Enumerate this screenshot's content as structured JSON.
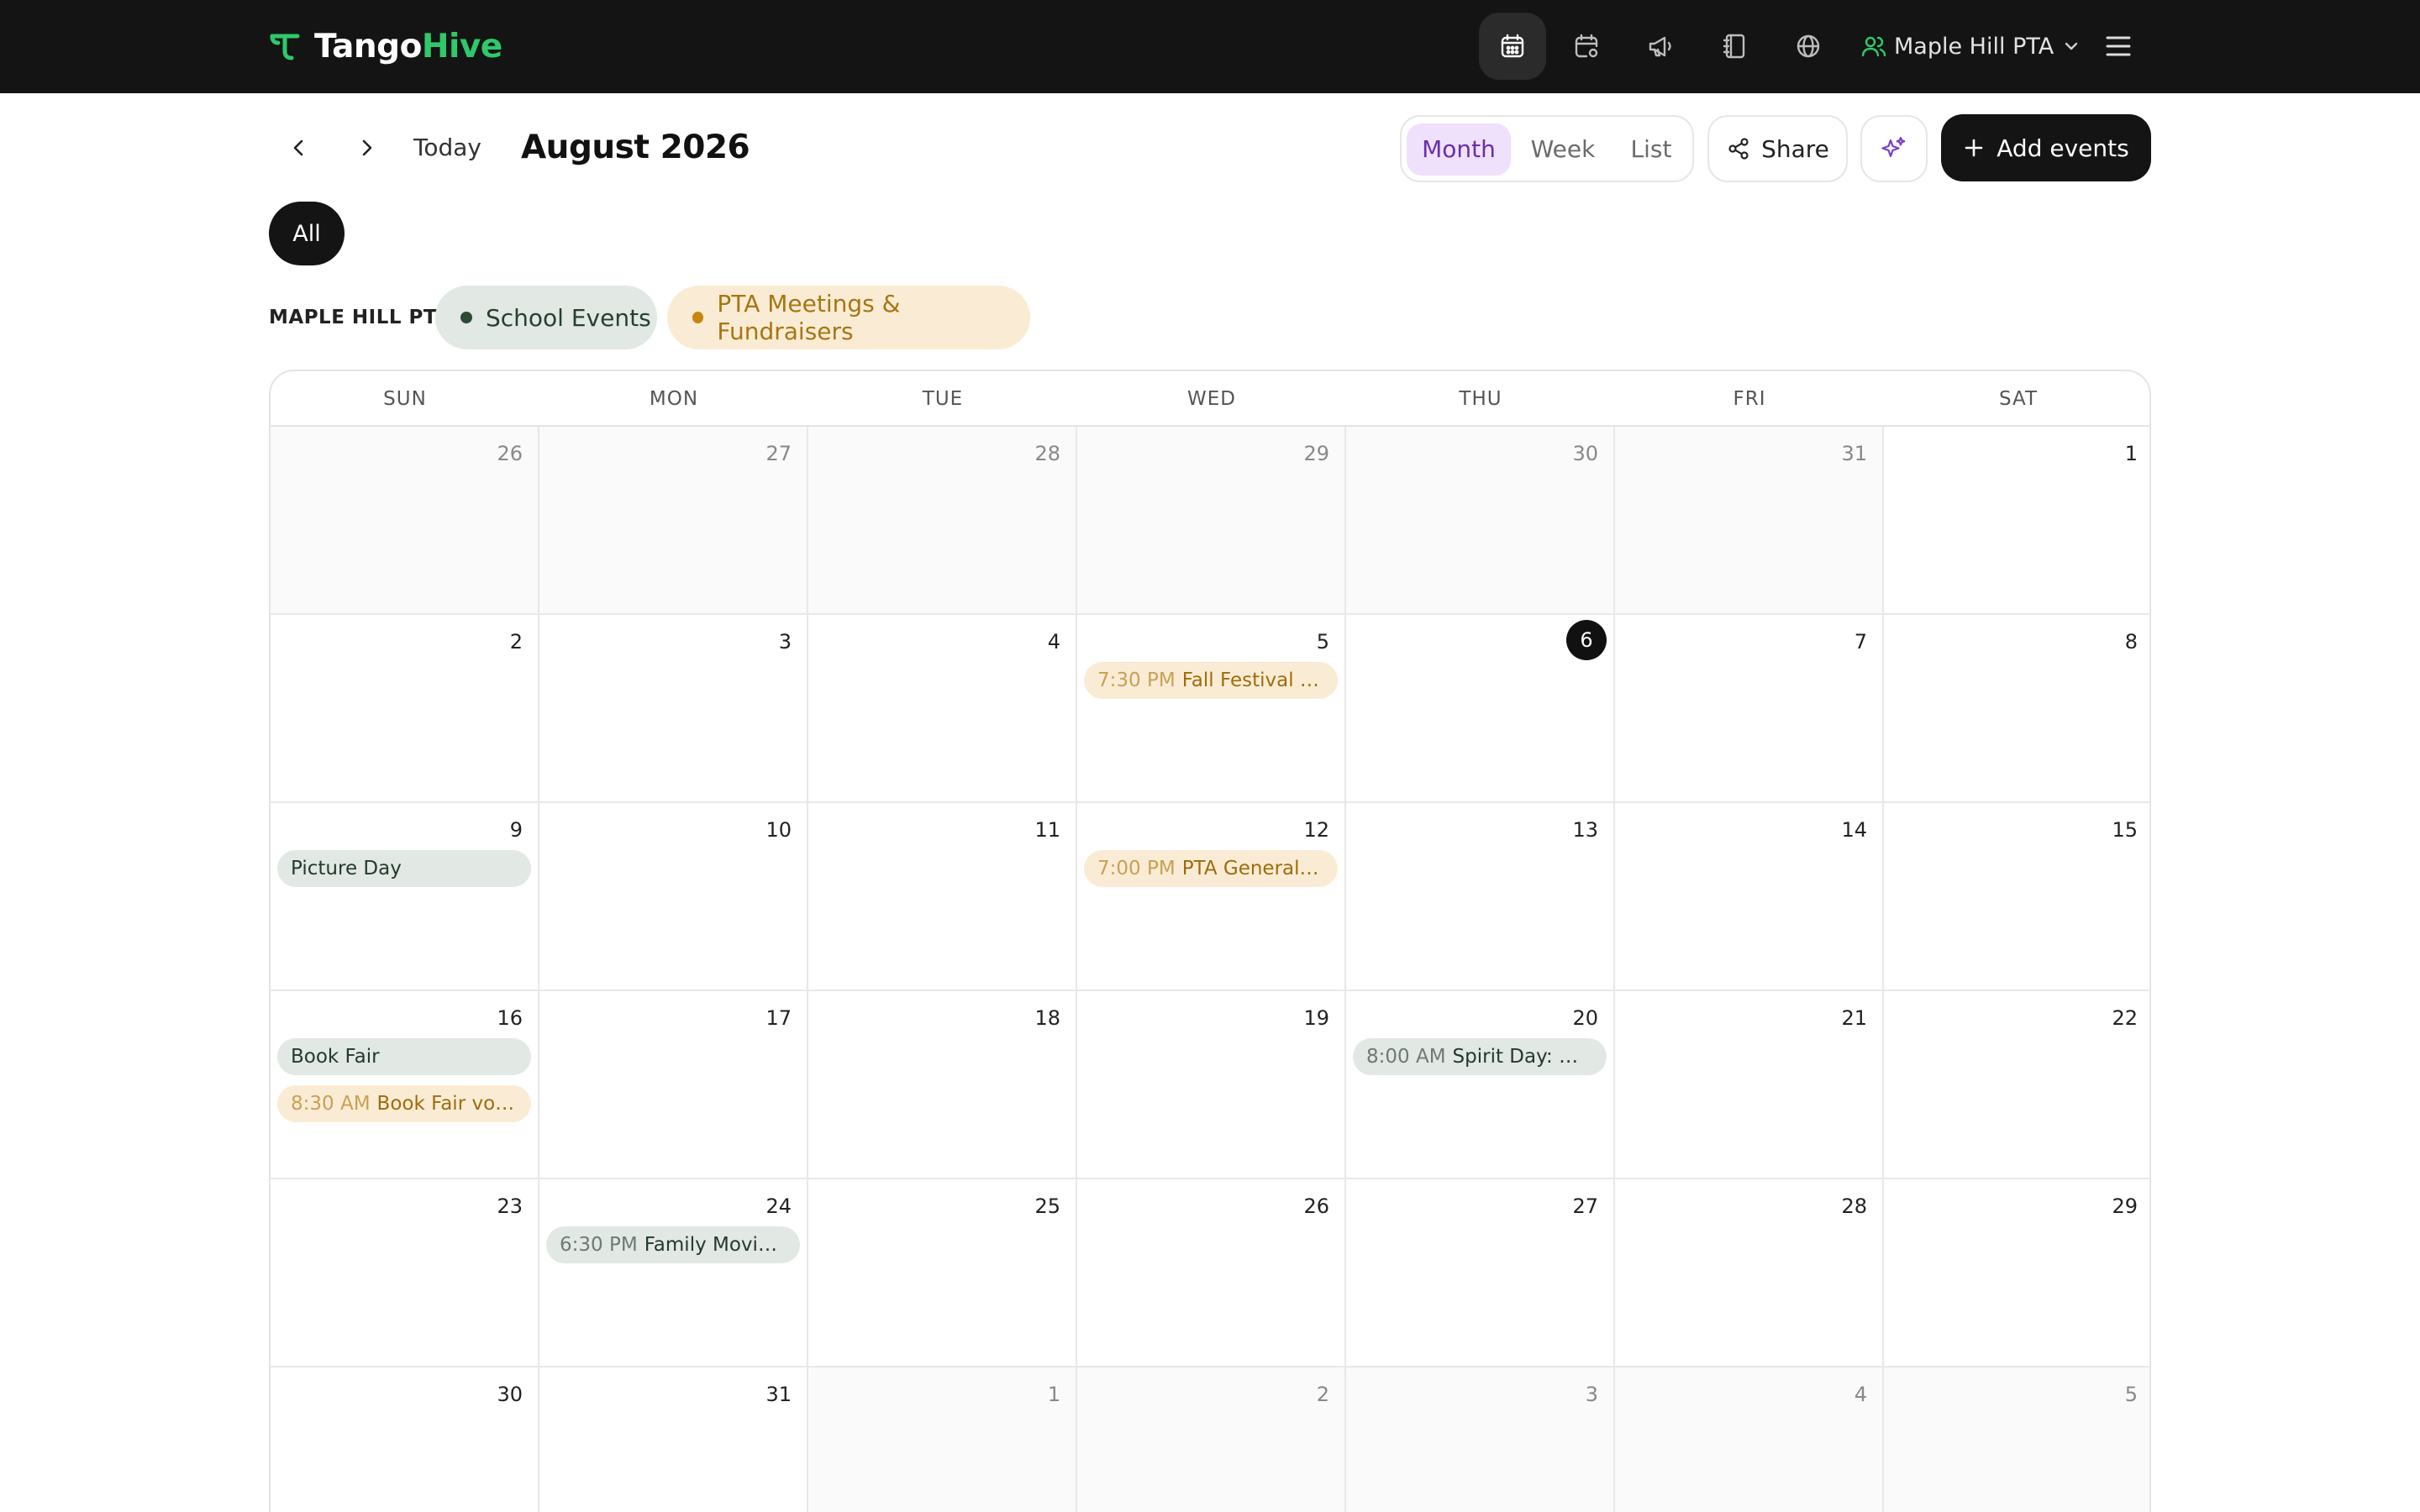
{
  "brand": {
    "name_part1": "Tango",
    "name_part2": "Hive"
  },
  "topnav": {
    "icons": [
      "calendar-icon",
      "calendar-settings-icon",
      "megaphone-icon",
      "notebook-icon",
      "globe-icon"
    ],
    "org_name": "Maple Hill PTA",
    "colors": {
      "bar": "#141414",
      "brand_accent": "#2fc86a"
    }
  },
  "toolbar": {
    "today_label": "Today",
    "month_title": "August 2026",
    "views": [
      "Month",
      "Week",
      "List"
    ],
    "active_view": "Month",
    "share_label": "Share",
    "add_label": "Add events"
  },
  "filters": {
    "all_label": "All",
    "group_label": "MAPLE HILL PTA",
    "calendars": [
      {
        "name": "School Events",
        "color": "#2c4a36"
      },
      {
        "name": "PTA Meetings & Fundraisers",
        "color": "#c8860f"
      }
    ]
  },
  "calendar": {
    "weekdays": [
      "SUN",
      "MON",
      "TUE",
      "WED",
      "THU",
      "FRI",
      "SAT"
    ],
    "today": 6,
    "weeks": [
      [
        {
          "d": "26",
          "out": true
        },
        {
          "d": "27",
          "out": true
        },
        {
          "d": "28",
          "out": true
        },
        {
          "d": "29",
          "out": true
        },
        {
          "d": "30",
          "out": true
        },
        {
          "d": "31",
          "out": true
        },
        {
          "d": "1"
        }
      ],
      [
        {
          "d": "2"
        },
        {
          "d": "3"
        },
        {
          "d": "4"
        },
        {
          "d": "5",
          "events": [
            {
              "time": "7:30 PM",
              "title": "Fall Festival planning",
              "cal": "pta"
            }
          ]
        },
        {
          "d": "6",
          "today": true
        },
        {
          "d": "7"
        },
        {
          "d": "8"
        }
      ],
      [
        {
          "d": "9",
          "events": [
            {
              "time": "",
              "title": "Picture Day",
              "cal": "school"
            }
          ]
        },
        {
          "d": "10"
        },
        {
          "d": "11"
        },
        {
          "d": "12",
          "events": [
            {
              "time": "7:00 PM",
              "title": "PTA General Meeting",
              "cal": "pta"
            }
          ]
        },
        {
          "d": "13"
        },
        {
          "d": "14"
        },
        {
          "d": "15"
        }
      ],
      [
        {
          "d": "16",
          "events": [
            {
              "time": "",
              "title": "Book Fair",
              "cal": "school"
            },
            {
              "time": "8:30 AM",
              "title": "Book Fair volunteers",
              "cal": "pta"
            }
          ]
        },
        {
          "d": "17"
        },
        {
          "d": "18"
        },
        {
          "d": "19"
        },
        {
          "d": "20",
          "events": [
            {
              "time": "8:00 AM",
              "title": "Spirit Day: wear school colors",
              "cal": "school"
            }
          ]
        },
        {
          "d": "21"
        },
        {
          "d": "22"
        }
      ],
      [
        {
          "d": "23"
        },
        {
          "d": "24",
          "events": [
            {
              "time": "6:30 PM",
              "title": "Family Movie Night",
              "cal": "school"
            }
          ]
        },
        {
          "d": "25"
        },
        {
          "d": "26"
        },
        {
          "d": "27"
        },
        {
          "d": "28"
        },
        {
          "d": "29"
        }
      ],
      [
        {
          "d": "30"
        },
        {
          "d": "31"
        },
        {
          "d": "1",
          "out": true
        },
        {
          "d": "2",
          "out": true
        },
        {
          "d": "3",
          "out": true
        },
        {
          "d": "4",
          "out": true
        },
        {
          "d": "5",
          "out": true
        }
      ]
    ]
  }
}
